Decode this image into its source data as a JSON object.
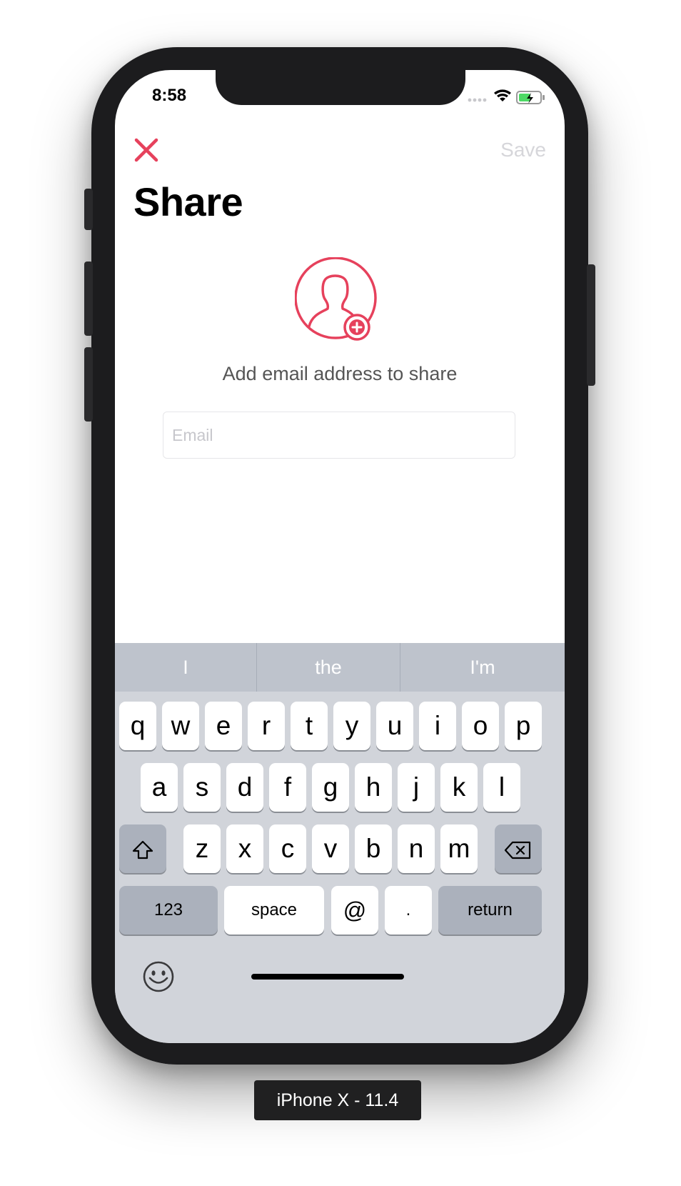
{
  "status": {
    "time": "8:58"
  },
  "nav": {
    "save_label": "Save"
  },
  "page": {
    "title": "Share",
    "subtitle": "Add email address to share"
  },
  "email": {
    "placeholder": "Email",
    "value": ""
  },
  "keyboard": {
    "suggestions": [
      "I",
      "the",
      "I'm"
    ],
    "row1": [
      "q",
      "w",
      "e",
      "r",
      "t",
      "y",
      "u",
      "i",
      "o",
      "p"
    ],
    "row2": [
      "a",
      "s",
      "d",
      "f",
      "g",
      "h",
      "j",
      "k",
      "l"
    ],
    "row3": [
      "z",
      "x",
      "c",
      "v",
      "b",
      "n",
      "m"
    ],
    "numbers_label": "123",
    "space_label": "space",
    "at_label": "@",
    "period_label": ".",
    "return_label": "return"
  },
  "device_label": "iPhone X - 11.4",
  "colors": {
    "accent": "#e6415c",
    "save_disabled": "#d6d6da",
    "keyboard_bg": "#d1d4da"
  },
  "icons": [
    "close-icon",
    "add-user-icon",
    "shift-icon",
    "delete-icon",
    "emoji-icon",
    "wifi-icon",
    "battery-icon",
    "signal-icon"
  ]
}
